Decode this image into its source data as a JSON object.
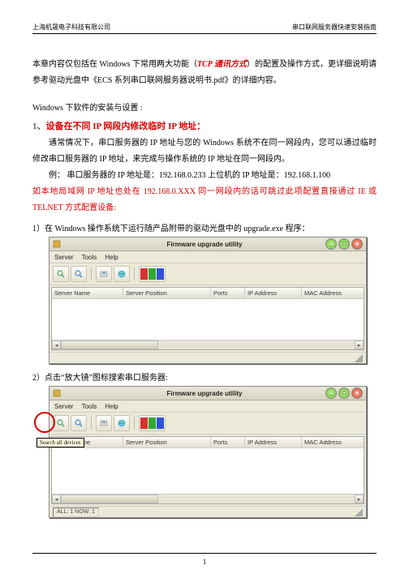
{
  "header": {
    "left": "上海机晟电子科技有限公司",
    "right": "串口联网服务器快速安装指南"
  },
  "intro": {
    "p1_pre": "本章内容仅包括在 Windows 下常用两大功能（",
    "p1_em": "TCP 通讯方式",
    "p1_post": "）的配置及操作方式，更详细说明请参考驱动光盘中《ECS 系列串口联网服务器说明书.pdf》的详细内容。"
  },
  "setup_title": "Windows 下软件的安装与设置 :",
  "section1": {
    "num": "1、",
    "title": "设备在不同 IP 网段内修改临时 IP 地址：",
    "p1": "通常情况下，串口服务器的 IP 地址与您的 Windows 系统不在同一网段内，您可以通过临时修改串口服务器的 IP 地址，来完成与操作系统的 IP 地址在同一网段内。",
    "example_pre": "例：  串口服务器的 IP 地址是：",
    "example_ip1": "192.168.0.233",
    "example_mid": "    上位机的 IP 地址是：",
    "example_ip2": "192.168.1.100",
    "warn": "如本地局域网 IP 地址也处在 192.168.0.XXX 同一网段内的话可跳过此项配置直接通过 IE 或 TELNET 方式配置设备:"
  },
  "step1": "1）在 Windows 操作系统下运行随产品附带的驱动光盘中的 upgrade.exe 程序：",
  "step2": "2）点击“放大镜”图标搜索串口服务器:",
  "window": {
    "title": "Firmware upgrade utility",
    "menus": [
      "Server",
      "Tools",
      "Help"
    ],
    "columns": {
      "name": "Server Name",
      "pos": "Server Position",
      "ports": "Ports",
      "ip": "IP Address",
      "mac": "MAC Address"
    },
    "tooltip": "Search all devices",
    "status_prefix": "ALL: 1 NOW: 1"
  },
  "page_number": "1"
}
